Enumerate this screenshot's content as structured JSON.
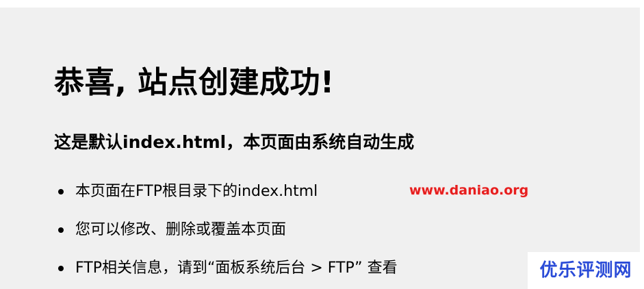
{
  "main": {
    "title": "恭喜, 站点创建成功!",
    "subtitle": "这是默认index.html，本页面由系统自动生成",
    "items": [
      {
        "text": "本页面在FTP根目录下的index.html"
      },
      {
        "text": "您可以修改、删除或覆盖本页面"
      },
      {
        "text": "FTP相关信息，请到“面板系统后台 > FTP” 查看"
      }
    ]
  },
  "watermark": {
    "url": "www.daniao.org",
    "brand": "优乐评测网"
  },
  "colors": {
    "panel_background": "#f0f0f0",
    "text": "#000000",
    "watermark_url": "#e61e1e",
    "watermark_brand": "#2a4bd7"
  }
}
